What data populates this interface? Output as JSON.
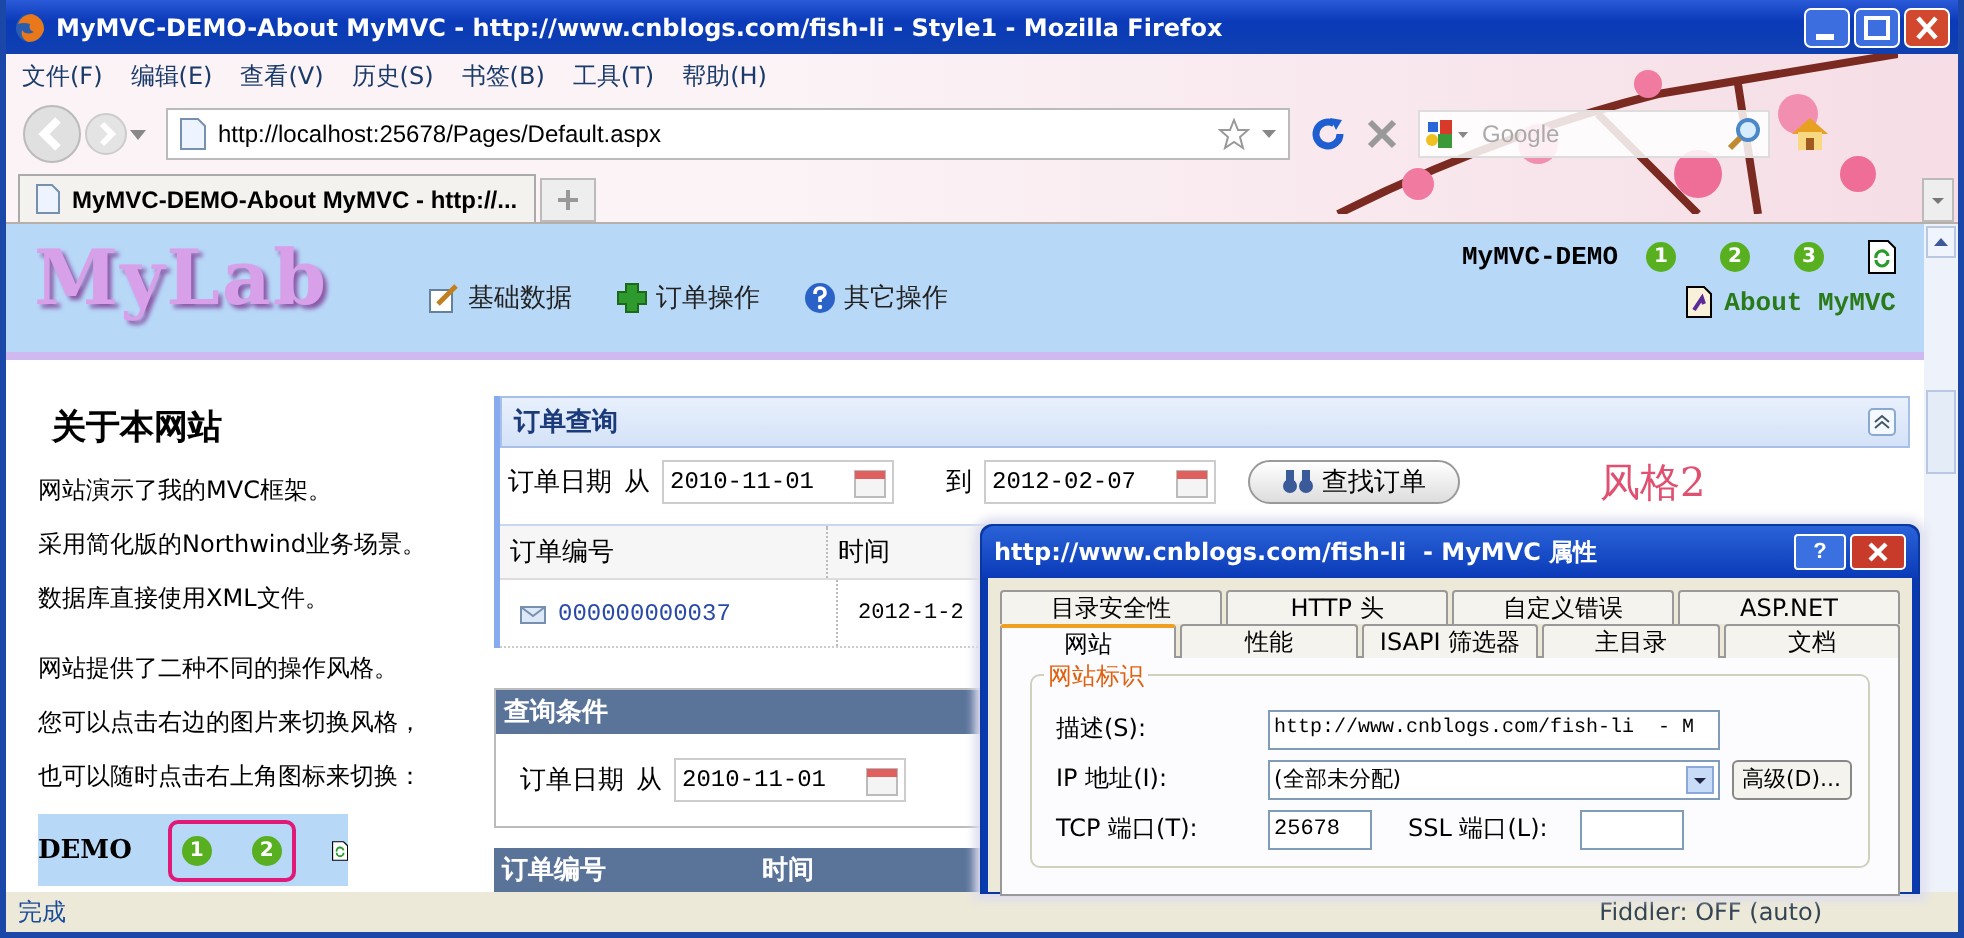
{
  "window": {
    "title": "MyMVC-DEMO-About MyMVC - http://www.cnblogs.com/fish-li - Style1 - Mozilla Firefox"
  },
  "menu": [
    "文件(F)",
    "编辑(E)",
    "查看(V)",
    "历史(S)",
    "书签(B)",
    "工具(T)",
    "帮助(H)"
  ],
  "address_bar": {
    "url": "http://localhost:25678/Pages/Default.aspx"
  },
  "search": {
    "placeholder": "Google"
  },
  "tabs": [
    {
      "label": "MyMVC-DEMO-About MyMVC - http://...",
      "selected": true
    }
  ],
  "site": {
    "logo": "MyLab",
    "nav": [
      {
        "label": "基础数据",
        "kind": "edit"
      },
      {
        "label": "订单操作",
        "kind": "add"
      },
      {
        "label": "其它操作",
        "kind": "help"
      }
    ],
    "name": "MyMVC-DEMO",
    "styles": [
      "1",
      "2",
      "3"
    ],
    "about_link": "About MyMVC"
  },
  "sidebar": {
    "heading": "关于本网站",
    "paragraphs": [
      "网站演示了我的MVC框架。",
      "采用简化版的Northwind业务场景。",
      "数据库直接使用XML文件。",
      "网站提供了二种不同的操作风格。",
      "您可以点击右边的图片来切换风格，",
      "也可以随时点击右上角图标来切换："
    ],
    "demo_label": "DEMO",
    "demo_styles": [
      "1",
      "2"
    ]
  },
  "order_query": {
    "title": "订单查询",
    "date_label": "订单日期",
    "from_label": "从",
    "from": "2010-11-01",
    "to_label": "到",
    "to": "2012-02-07",
    "button": "查找订单",
    "style_caption": "风格2",
    "columns": [
      "订单编号",
      "时间"
    ],
    "rows": [
      {
        "order_no": "000000000037",
        "time": "2012-1-2"
      }
    ]
  },
  "query_conditions": {
    "title": "查询条件",
    "date_label": "订单日期",
    "from_label": "从",
    "from": "2010-11-01"
  },
  "results": {
    "columns": [
      "订单编号",
      "时间"
    ]
  },
  "dialog": {
    "title": "http://www.cnblogs.com/fish-li  - MyMVC 属性",
    "help": "?",
    "tab_rows": [
      [
        {
          "label": "目录安全性",
          "selected": false
        },
        {
          "label": "HTTP 头",
          "selected": false
        },
        {
          "label": "自定义错误",
          "selected": false
        },
        {
          "label": "ASP.NET",
          "selected": false
        }
      ],
      [
        {
          "label": "网站",
          "selected": true
        },
        {
          "label": "性能",
          "selected": false
        },
        {
          "label": "ISAPI 筛选器",
          "selected": false
        },
        {
          "label": "主目录",
          "selected": false
        },
        {
          "label": "文档",
          "selected": false
        }
      ]
    ],
    "group": "网站标识",
    "description_label": "描述(S):",
    "description": "http://www.cnblogs.com/fish-li  - M",
    "ip_label": "IP 地址(I):",
    "ip": "(全部未分配)",
    "advanced_button": "高级(D)...",
    "tcp_label": "TCP 端口(T):",
    "tcp": "25678",
    "ssl_label": "SSL 端口(L):"
  },
  "status_bar": {
    "text": "完成",
    "fiddler": "Fiddler: OFF (auto)"
  }
}
